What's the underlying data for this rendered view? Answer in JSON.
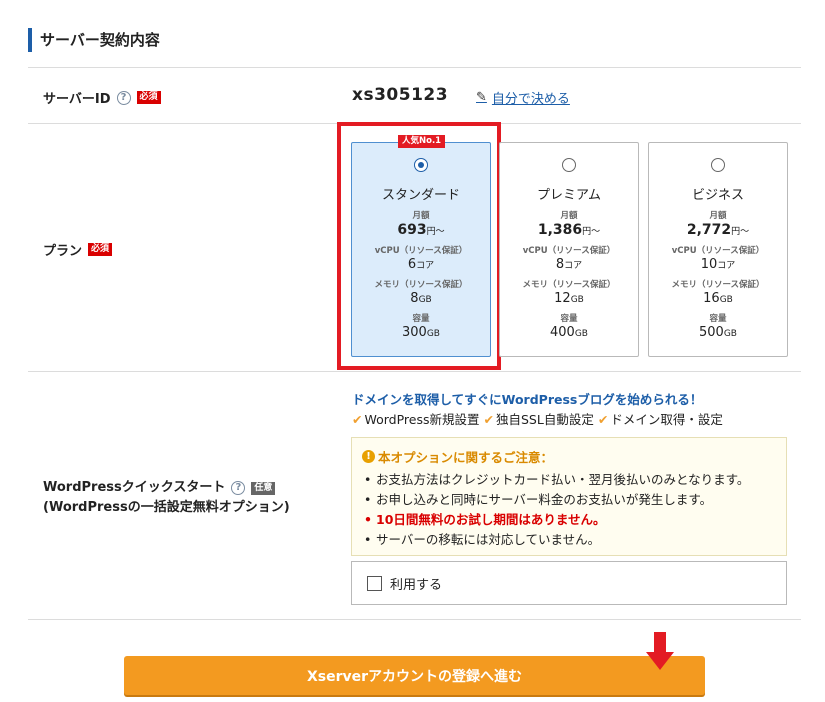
{
  "section": {
    "title": "サーバー契約内容"
  },
  "server_id_row": {
    "label": "サーバーID",
    "help": "?",
    "required_badge": "必須",
    "value": "xs305123",
    "self_decide_link": "自分で決める"
  },
  "plan_row": {
    "label": "プラン",
    "required_badge": "必須",
    "popular_badge": "人気No.1",
    "plans": [
      {
        "name": "スタンダード",
        "monthly_label": "月額",
        "price": "693",
        "price_unit": "円〜",
        "cpu_label": "vCPU（リソース保証）",
        "cpu": "6",
        "cpu_unit": "コア",
        "mem_label": "メモリ（リソース保証）",
        "mem": "8",
        "mem_unit": "GB",
        "storage_label": "容量",
        "storage": "300",
        "storage_unit": "GB",
        "selected": true
      },
      {
        "name": "プレミアム",
        "monthly_label": "月額",
        "price": "1,386",
        "price_unit": "円〜",
        "cpu_label": "vCPU（リソース保証）",
        "cpu": "8",
        "cpu_unit": "コア",
        "mem_label": "メモリ（リソース保証）",
        "mem": "12",
        "mem_unit": "GB",
        "storage_label": "容量",
        "storage": "400",
        "storage_unit": "GB",
        "selected": false
      },
      {
        "name": "ビジネス",
        "monthly_label": "月額",
        "price": "2,772",
        "price_unit": "円〜",
        "cpu_label": "vCPU（リソース保証）",
        "cpu": "10",
        "cpu_unit": "コア",
        "mem_label": "メモリ（リソース保証）",
        "mem": "16",
        "mem_unit": "GB",
        "storage_label": "容量",
        "storage": "500",
        "storage_unit": "GB",
        "selected": false
      }
    ]
  },
  "wp_row": {
    "label_line1": "WordPressクイックスタート",
    "help": "?",
    "optional_badge": "任意",
    "label_line2": "(WordPressの一括設定無料オプション)",
    "heading": "ドメインを取得してすぐにWordPressブログを始められる！",
    "features": [
      "WordPress新規設置",
      "独自SSL自動設定",
      "ドメイン取得・設定"
    ],
    "notice": {
      "icon": "!",
      "title": "本オプションに関するご注意：",
      "items": [
        "お支払方法はクレジットカード払い・翌月後払いのみとなります。",
        "お申し込みと同時にサーバー料金のお支払いが発生します。",
        "10日間無料のお試し期間はありません。",
        "サーバーの移転には対応していません。"
      ]
    },
    "use_label": "利用する"
  },
  "cta": {
    "label": "Xserverアカウントの登録へ進む"
  },
  "colors": {
    "accent": "#1d5ea8",
    "required": "#d90000",
    "cta": "#f39a20",
    "highlight_frame": "#e31b23"
  }
}
